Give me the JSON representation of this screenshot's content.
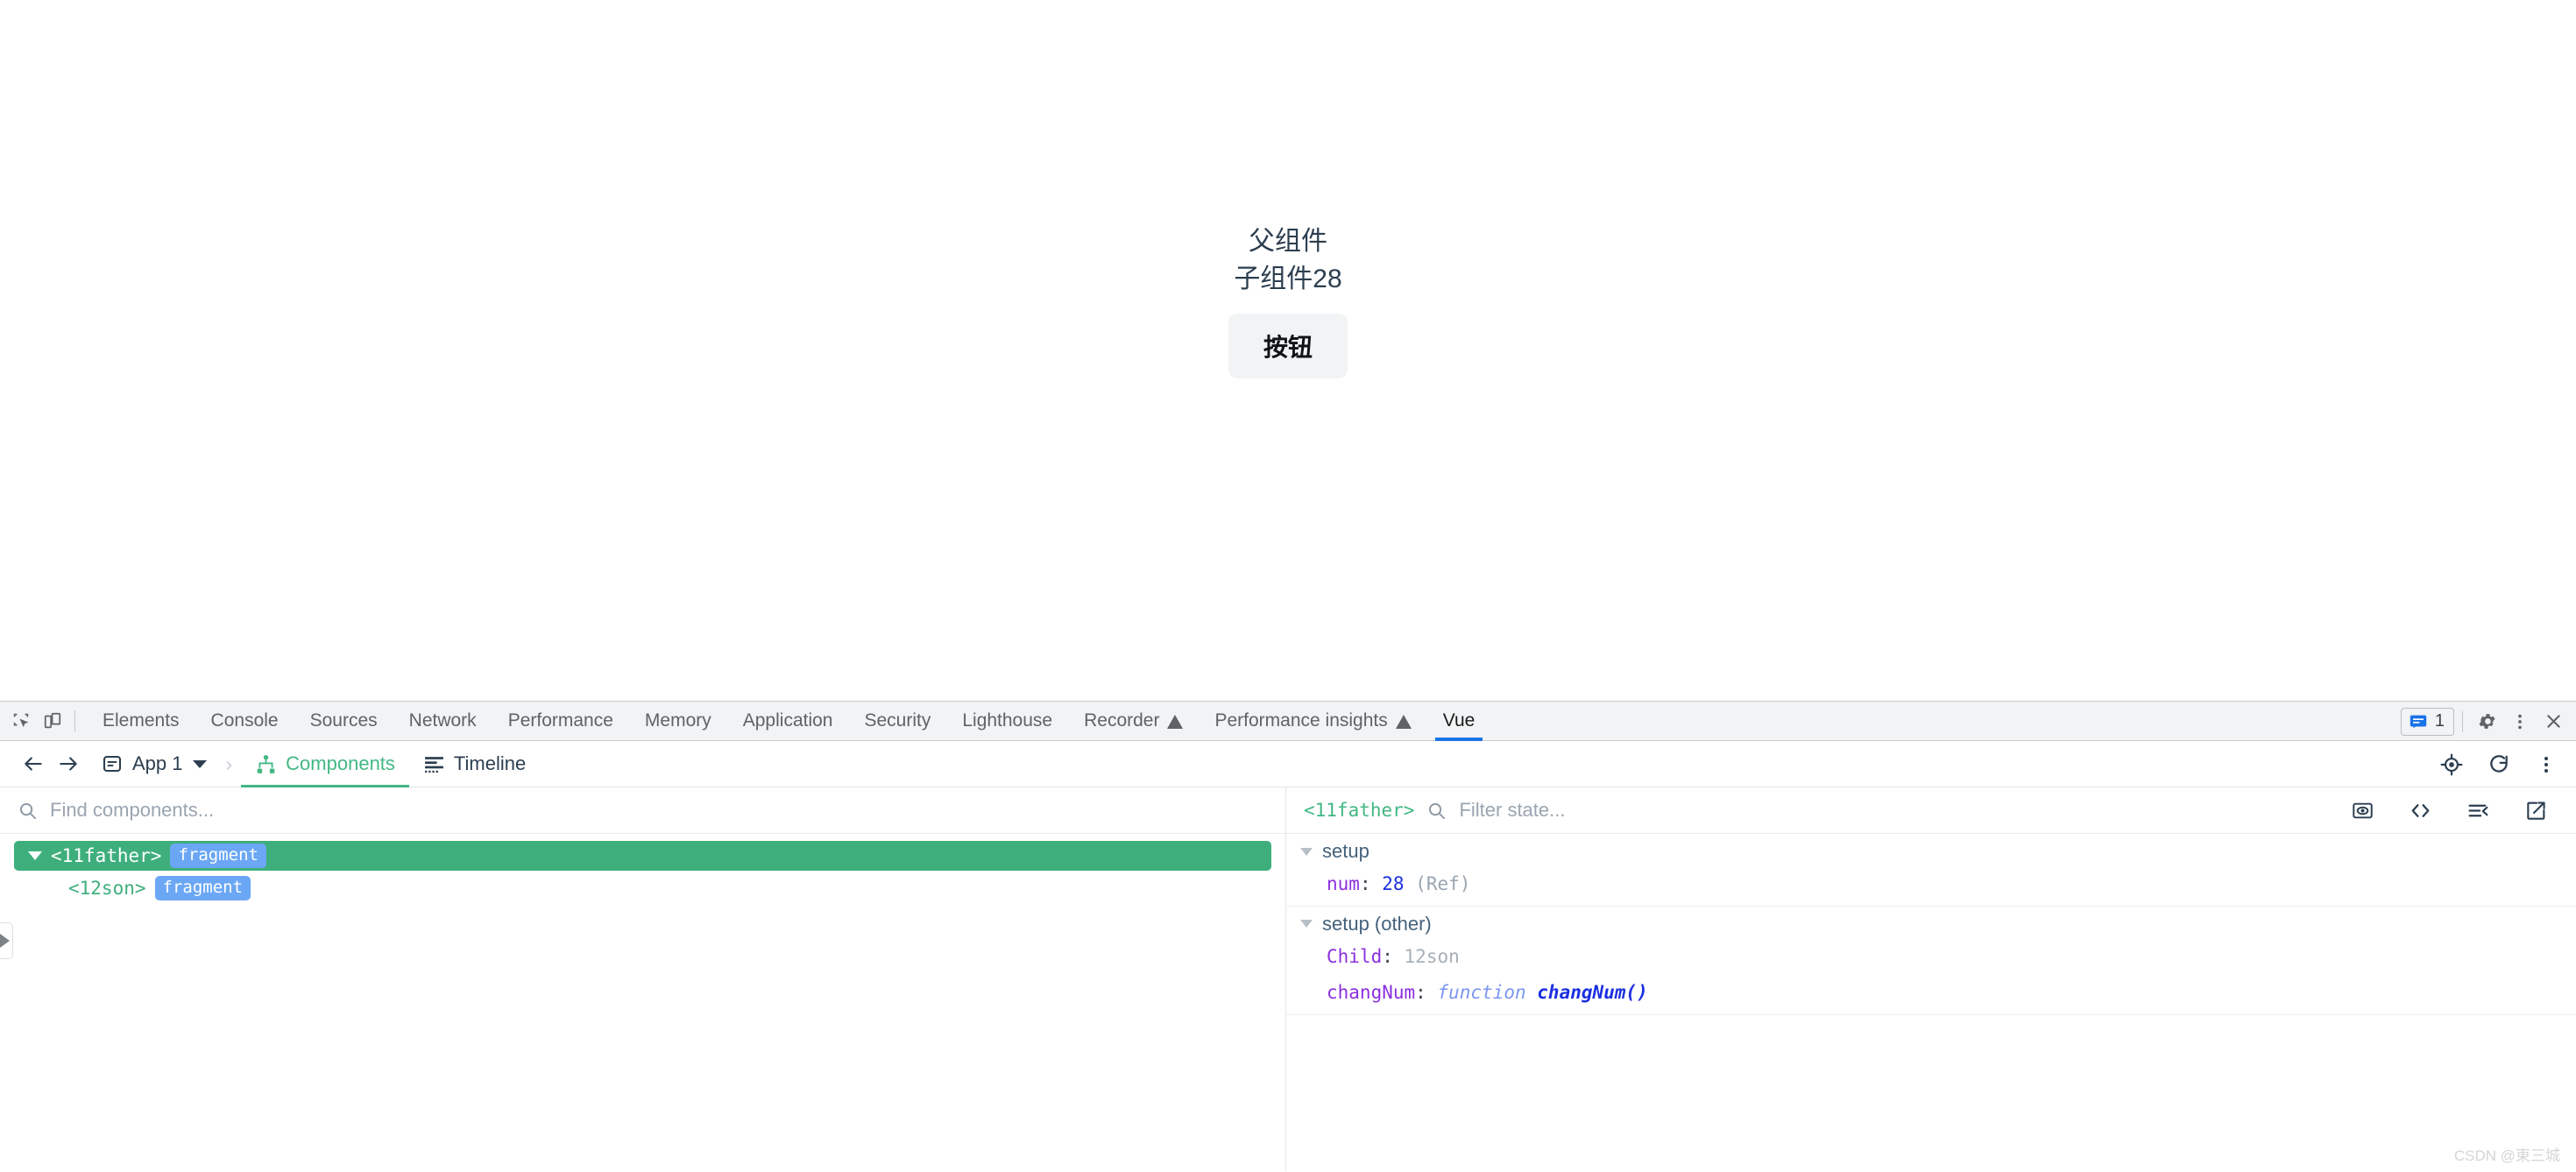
{
  "page": {
    "parent_label": "父组件",
    "child_label": "子组件28",
    "button_label": "按钮"
  },
  "devtools": {
    "left_icons": [
      {
        "name": "inspect-element-icon"
      },
      {
        "name": "device-toolbar-icon"
      }
    ],
    "tabs": [
      {
        "label": "Elements",
        "active": false,
        "experimental": false
      },
      {
        "label": "Console",
        "active": false,
        "experimental": false
      },
      {
        "label": "Sources",
        "active": false,
        "experimental": false
      },
      {
        "label": "Network",
        "active": false,
        "experimental": false
      },
      {
        "label": "Performance",
        "active": false,
        "experimental": false
      },
      {
        "label": "Memory",
        "active": false,
        "experimental": false
      },
      {
        "label": "Application",
        "active": false,
        "experimental": false
      },
      {
        "label": "Security",
        "active": false,
        "experimental": false
      },
      {
        "label": "Lighthouse",
        "active": false,
        "experimental": false
      },
      {
        "label": "Recorder",
        "active": false,
        "experimental": true
      },
      {
        "label": "Performance insights",
        "active": false,
        "experimental": true
      },
      {
        "label": "Vue",
        "active": true,
        "experimental": false
      }
    ],
    "message_count": "1",
    "accent_color": "#1a73e8",
    "right_icons": [
      {
        "name": "console-message-badge"
      },
      {
        "name": "settings-gear-icon"
      },
      {
        "name": "more-options-icon"
      },
      {
        "name": "close-devtools-icon"
      }
    ]
  },
  "vue_panel": {
    "back_label": "Back",
    "forward_label": "Forward",
    "app_name": "App 1",
    "breadcrumb_separator": "›",
    "tabs": [
      {
        "label": "Components",
        "active": true
      },
      {
        "label": "Timeline",
        "active": false
      }
    ],
    "toolbar_right_icons": [
      {
        "name": "select-component-icon"
      },
      {
        "name": "refresh-icon"
      },
      {
        "name": "vue-more-options-icon"
      }
    ],
    "accent_color": "#42b883",
    "tree": {
      "search_placeholder": "Find components...",
      "search_value": "",
      "nodes": [
        {
          "name": "<11father>",
          "badge": "fragment",
          "selected": true,
          "expanded": true,
          "depth": 0
        },
        {
          "name": "<12son>",
          "badge": "fragment",
          "selected": false,
          "expanded": false,
          "depth": 1
        }
      ]
    },
    "state": {
      "selected_component": "<11father>",
      "filter_placeholder": "Filter state...",
      "filter_value": "",
      "icons": [
        {
          "name": "scroll-to-component-icon"
        },
        {
          "name": "inspect-dom-icon"
        },
        {
          "name": "collapse-all-icon"
        },
        {
          "name": "open-in-editor-icon"
        }
      ],
      "groups": [
        {
          "title": "setup",
          "expanded": true,
          "items": [
            {
              "key": "num",
              "value": "28",
              "value_kind": "number",
              "meta": "(Ref)"
            }
          ]
        },
        {
          "title": "setup (other)",
          "expanded": true,
          "items": [
            {
              "key": "Child",
              "value": "12son",
              "value_kind": "string",
              "meta": ""
            },
            {
              "key": "changNum",
              "value": "changNum()",
              "value_kind": "function",
              "meta": "function"
            }
          ]
        }
      ]
    }
  },
  "watermark": "CSDN @東三城"
}
